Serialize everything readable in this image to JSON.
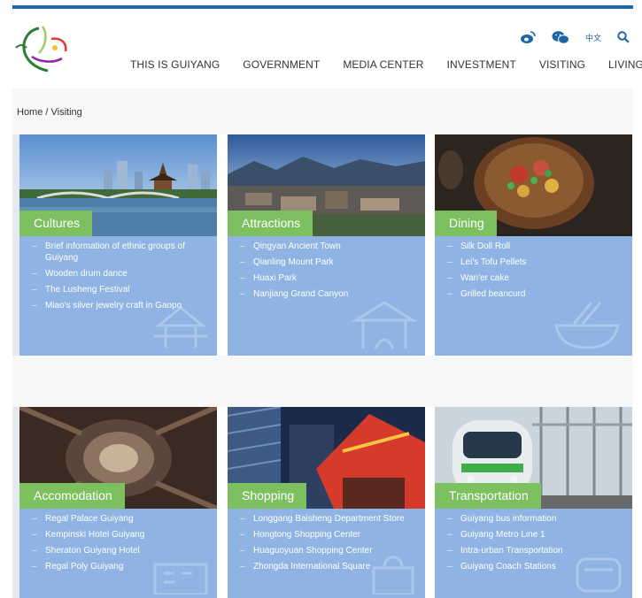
{
  "header": {
    "nav": [
      "THIS IS GUIYANG",
      "GOVERNMENT",
      "MEDIA CENTER",
      "INVESTMENT",
      "VISITING",
      "LIVING"
    ],
    "lang_label": "中文",
    "icons": [
      "weibo-icon",
      "wechat-icon",
      "search-icon"
    ]
  },
  "breadcrumb": {
    "home": "Home",
    "separator": "/",
    "current": "Visiting"
  },
  "cards": [
    {
      "title": "Cultures",
      "items": [
        "Brief information of ethnic groups of Guiyang",
        "Wooden drum dance",
        "The Lusheng Festival",
        "Miao's silver jewelry craft in Gaopo"
      ]
    },
    {
      "title": "Attractions",
      "items": [
        "Qingyan Ancient Town",
        "Qianling Mount Park",
        "Huaxi Park",
        "Nanjiang Grand Canyon"
      ]
    },
    {
      "title": "Dining",
      "items": [
        "Silk Doll Roll",
        "Lei's Tofu Pellets",
        "Wan'er cake",
        "Grilled beancurd"
      ]
    },
    {
      "title": "Accomodation",
      "items": [
        "Regal Palace Guiyang",
        "Kempinski Hotel Guiyang",
        "Sheraton Guiyang Hotel",
        "Regal Poly Guiyang"
      ]
    },
    {
      "title": "Shopping",
      "items": [
        "Longgang Baisheng Department Store",
        "Hongtong Shopping Center",
        "Huaguoyuan Shopping Center",
        "Zhongda International Square"
      ]
    },
    {
      "title": "Transportation",
      "items": [
        "Guiyang bus information",
        "Guiyang Metro Line 1",
        "Intra-urban Transportation",
        "Guiyang Coach Stations"
      ]
    }
  ],
  "colors": {
    "accent_blue": "#1f66a8",
    "card_blue": "#8fb4e3",
    "label_green": "#7cc060"
  }
}
